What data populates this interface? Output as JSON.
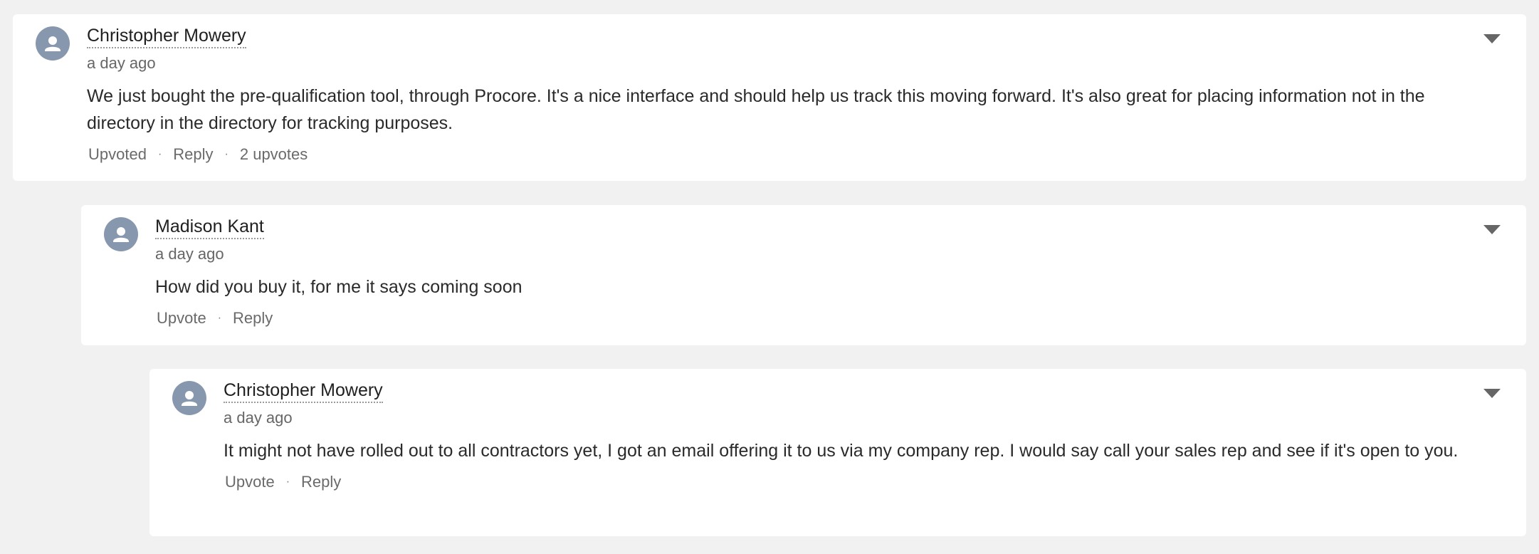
{
  "comments": [
    {
      "author": "Christopher Mowery",
      "time": "a day ago",
      "text": "We just bought the pre-qualification tool, through Procore. It's a nice interface and should help us track this moving forward. It's also great for placing information not in the directory in the directory for tracking purposes.",
      "upvote_label": "Upvoted",
      "reply_label": "Reply",
      "upvote_count": "2 upvotes",
      "avatar_icon": "user-avatar-icon",
      "menu_icon": "caret-down-icon"
    },
    {
      "author": "Madison Kant",
      "time": "a day ago",
      "text": "How did you buy it, for me it says coming soon",
      "upvote_label": "Upvote",
      "reply_label": "Reply",
      "avatar_icon": "user-avatar-icon",
      "menu_icon": "caret-down-icon"
    },
    {
      "author": "Christopher Mowery",
      "time": "a day ago",
      "text": "It might not have rolled out to all contractors yet, I got an email offering it to us via my company rep. I would say call your sales rep and see if it's open to you.",
      "upvote_label": "Upvote",
      "reply_label": "Reply",
      "avatar_icon": "user-avatar-icon",
      "menu_icon": "caret-down-icon"
    }
  ],
  "separator": "·",
  "colors": {
    "background": "#f1f1f1",
    "card": "#ffffff",
    "avatar": "#8797ae",
    "muted_text": "#666666"
  }
}
